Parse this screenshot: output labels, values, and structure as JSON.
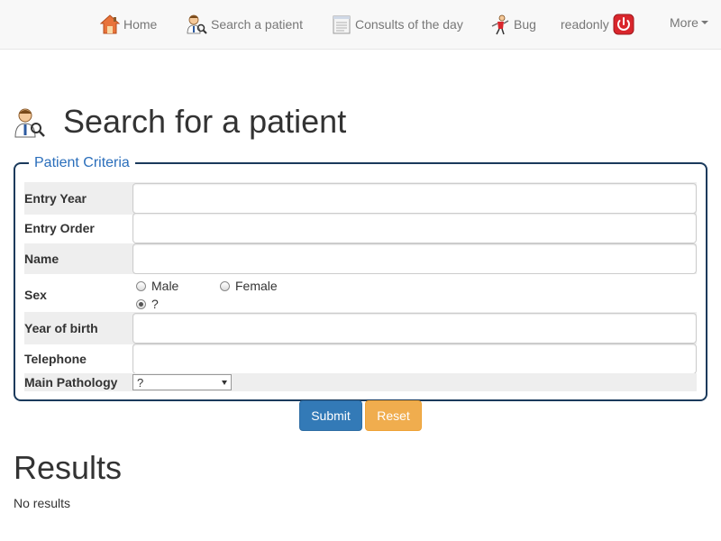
{
  "navbar": {
    "items": [
      {
        "label": "Home",
        "icon": "home-icon"
      },
      {
        "label": "Search a patient",
        "icon": "search-patient-icon"
      },
      {
        "label": "Consults of the day",
        "icon": "calendar-icon"
      },
      {
        "label": "Bug",
        "icon": "bug-icon"
      },
      {
        "label": "readonly",
        "icon": "power-icon"
      }
    ],
    "more_label": "More"
  },
  "page": {
    "title": "Search for a patient"
  },
  "criteria": {
    "legend": "Patient Criteria",
    "fields": {
      "entry_year": {
        "label": "Entry Year",
        "value": ""
      },
      "entry_order": {
        "label": "Entry Order",
        "value": ""
      },
      "name": {
        "label": "Name",
        "value": ""
      },
      "sex": {
        "label": "Sex",
        "options": [
          "Male",
          "Female",
          "?"
        ],
        "selected": "?"
      },
      "year_of_birth": {
        "label": "Year of birth",
        "value": ""
      },
      "telephone": {
        "label": "Telephone",
        "value": ""
      },
      "main_pathology": {
        "label": "Main Pathology",
        "selected": "?"
      }
    }
  },
  "actions": {
    "submit_label": "Submit",
    "reset_label": "Reset"
  },
  "results": {
    "title": "Results",
    "empty_text": "No results"
  },
  "colors": {
    "primary": "#337ab7",
    "warning": "#f0ad4e",
    "legend": "#2a6ebb",
    "fieldset_border": "#1a3a5c",
    "power_red": "#d9262c"
  }
}
